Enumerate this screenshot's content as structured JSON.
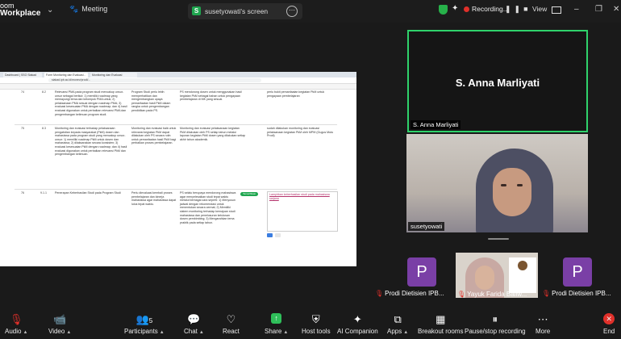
{
  "app": {
    "brand_line1": "oom",
    "brand_line2": "Workplace",
    "meeting_label": "Meeting"
  },
  "share": {
    "badge": "S",
    "title": "susetyowati's screen"
  },
  "recording": {
    "label": "Recording...",
    "view_label": "View"
  },
  "browser": {
    "tabs": [
      "Dashboard | SSO Siakad",
      "Form Monitoring dan Evaluasi - P",
      "Monitoring dan Evaluasi Pelaksana"
    ],
    "url": "siakad.ipb.ac.id/monev/prodi/..."
  },
  "sheet": {
    "rows": [
      {
        "no": "74",
        "code": "8.2",
        "desc": "Relevansi PMA pada program studi mencakup unsur-unsur sebagai berikut: 1) memiliki roadmap yang memayungi tema dan kelompok PMA untuk; 2) pelaksanaan PMA sesuai dengan roadmap PMA; 3) evaluasi kesesuaian PMA dengan roadmap; dan 4) hasil evaluasi digunakan untuk perbaikan relevansi PMA dan pengembangan keilmuan program studi.",
        "indicator": "Program Studi perlu lebih memperhatikan dan mengembangkan upaya pemanfaatan hasil PkM dalam rangka untuk pengembangan pendidikan pada PS.",
        "finding": "PS mendorong dosen untuk menggunakan hasil kegiatan PkM sebagai bahan untuk pengayaan pembelajaran di MK yang sesuai.",
        "action": "perlu bukti pemanfaatan kegiatan PkM untuk pengayaan pembelajaran"
      },
      {
        "no": "75",
        "code": "8.3",
        "desc": "Monitoring dan evaluasi terhadap pelaksanaan pengabdian kepada masyarakat (PkM) dosen dan mahasiswa pada program studi yang mencakup unsur-unsur: 1) memiliki roadmap PkM untuk dosen dan mahasiswa; 2) dilaksanakan secara konsisten; 3) evaluasi kesesuaian PkM dengan roadmap; dan 4) hasil evaluasi digunakan untuk perbaikan relevansi PkM dan pengembangan keilmuan.",
        "indicator": "Monitoring dan evaluasi baik untuk relevansi kegiatan PkM dapat dilakukan oleh PS secara rutin untuk pemanfaatan hasil PkM bagi perbaikan proses pembelajaran.",
        "finding": "Monitoring dan evaluasi pelaksanaan kegiatan PkM dilakukan oleh PS setiap tahun melalui laporan kegiatan PkM dosen yang dilakukan setiap akhir tahun akademik.",
        "action": "sudah dilakukan monitoring dan evaluasi pelaksanaan kegiatan PkM oleh MPM (Gugus Mutu Prodi)"
      },
      {
        "no": "76",
        "code": "9.1.1",
        "desc": "Penerapan Keberhasilan Studi pada Program Studi",
        "indicator": "Perlu dievaluasi kembali proses pembelajaran dan kinerja mahasiswa agar mahasiswa dapat lulus tepat waktu.",
        "status": "Terverifikasi",
        "finding": "PS selalu berupaya mendorong mahasiswa agar menyelesaikan studi tepat waktu melalui berbagai cara seperti: 1) Menyusun jadwal dengan rekomendasi untuk menentukan secara cermat; 2) Memiliki sistem monitoring terhadap kemajuan studi mahasiswa dan penelusuran kelulusan dosen pembimbing; 3) Mengarahkan tema praktik pada setiap tahun.",
        "action_link": "Lampirkan keberhasilan studi pada mahasiswa sarjana"
      }
    ]
  },
  "participants": {
    "main_name": "S. Anna Marliyati",
    "main_tag": "S. Anna Marliyati",
    "video_tag": "susetyowati",
    "tiles": [
      {
        "initial": "P",
        "name": "Prodi Dietisien IPB..."
      },
      {
        "name": "Yayuk Farida Baliw..."
      },
      {
        "initial": "P",
        "name": "Prodi Dietisien IPB..."
      }
    ]
  },
  "toolbar": {
    "audio": "Audio",
    "video": "Video",
    "participants": "Participants",
    "participants_count": "5",
    "chat": "Chat",
    "react": "React",
    "share": "Share",
    "host_tools": "Host tools",
    "ai_companion": "AI Companion",
    "apps": "Apps",
    "breakout": "Breakout rooms",
    "pause_record": "Pause/stop recording",
    "more": "More",
    "end": "End"
  },
  "colors": {
    "active_speaker": "#2fd26b",
    "record": "#e0302a",
    "share_green": "#1fa64f",
    "avatar_purple": "#7a3fa6"
  }
}
